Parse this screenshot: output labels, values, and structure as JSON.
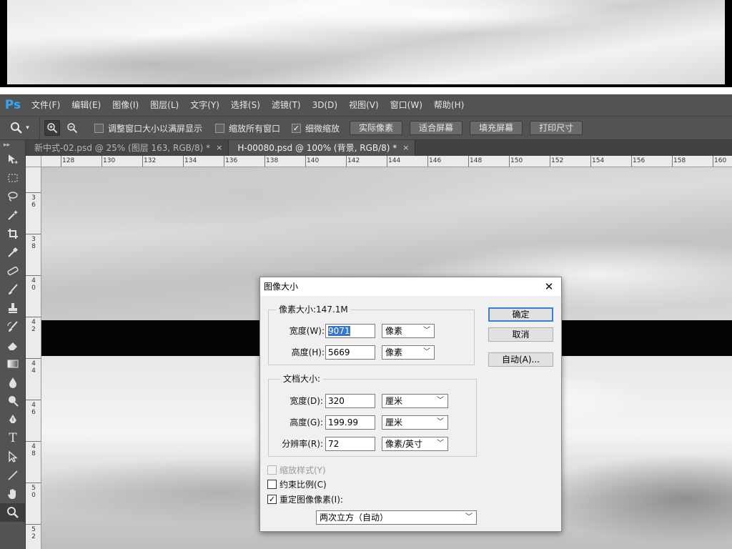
{
  "menubar": {
    "logo": "Ps",
    "items": [
      "文件(F)",
      "编辑(E)",
      "图像(I)",
      "图层(L)",
      "文字(Y)",
      "选择(S)",
      "滤镜(T)",
      "3D(D)",
      "视图(V)",
      "窗口(W)",
      "帮助(H)"
    ]
  },
  "options": {
    "tool_arrow": "▾",
    "resize_windows": "调整窗口大小以满屏显示",
    "zoom_all_windows": "缩放所有窗口",
    "scrubby_zoom": "细微缩放",
    "scrubby_zoom_checked": "✓",
    "actual_pixels": "实际像素",
    "fit_screen": "适合屏幕",
    "fill_screen": "填充屏幕",
    "print_size": "打印尺寸"
  },
  "tabs": [
    {
      "label": "新中式-02.psd @ 25% (图层 163, RGB/8) *",
      "close": "×"
    },
    {
      "label": "H-00080.psd @ 100% (背景, RGB/8) *",
      "close": "×"
    }
  ],
  "toolbox": {
    "grip": "▸▸",
    "type_tool": "T"
  },
  "ruler_top": [
    "128",
    "130",
    "132",
    "134",
    "136",
    "138",
    "140",
    "142",
    "144",
    "146",
    "148",
    "150",
    "152",
    "154",
    "156",
    "158",
    "160"
  ],
  "ruler_left": [
    "3 6",
    "3 8",
    "4 0",
    "4 2",
    "4 4",
    "4 6",
    "4 8",
    "5 0",
    "5 2"
  ],
  "dialog": {
    "title": "图像大小",
    "close": "✕",
    "pixel_dimensions": {
      "title": "像素大小:147.1M",
      "width_label": "宽度(W):",
      "width_value": "9071",
      "width_unit": "像素",
      "height_label": "高度(H):",
      "height_value": "5669",
      "height_unit": "像素"
    },
    "document_size": {
      "title": "文档大小:",
      "width_label": "宽度(D):",
      "width_value": "320",
      "width_unit": "厘米",
      "height_label": "高度(G):",
      "height_value": "199.99",
      "height_unit": "厘米",
      "resolution_label": "分辨率(R):",
      "resolution_value": "72",
      "resolution_unit": "像素/英寸"
    },
    "scale_styles": "缩放样式(Y)",
    "constrain_proportions": "约束比例(C)",
    "resample_image": "重定图像像素(I):",
    "resample_checked": "✓",
    "resample_method": "两次立方（自动）",
    "ok": "确定",
    "cancel": "取消",
    "auto": "自动(A)...",
    "dropdown_arrow": "﹀"
  }
}
